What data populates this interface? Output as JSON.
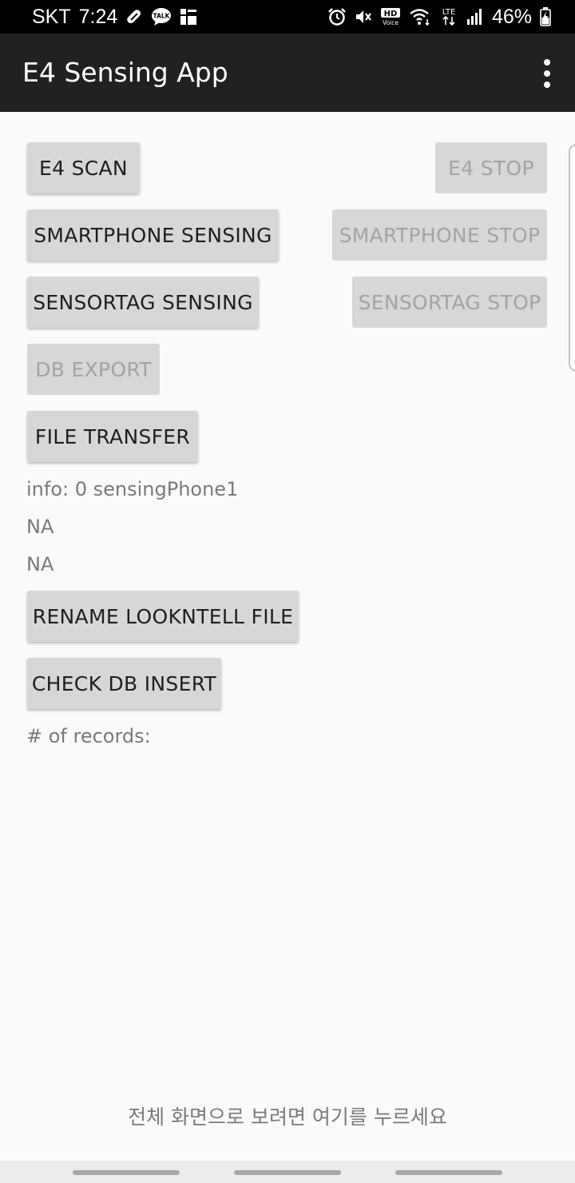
{
  "status_bar": {
    "carrier": "SKT",
    "time": "7:24",
    "battery_percent": "46%",
    "left_icons": [
      "pill-icon",
      "talk-icon",
      "news-icon"
    ],
    "right_icons": [
      "alarm-icon",
      "mute-icon",
      "hd-voice-icon",
      "wifi-icon",
      "lte-icon",
      "signal-icon",
      "battery-charging-icon"
    ],
    "hd_label": "HD",
    "voice_label": "Voice",
    "lte_label": "LTE",
    "talk_label": "TALK"
  },
  "app_bar": {
    "title": "E4 Sensing App",
    "menu_icon": "more-vert-icon"
  },
  "buttons": {
    "e4_scan": "E4 SCAN",
    "e4_stop": "E4 STOP",
    "smartphone_sensing": "SMARTPHONE SENSING",
    "smartphone_stop": "SMARTPHONE STOP",
    "sensortag_sensing": "SENSORTAG SENSING",
    "sensortag_stop": "SENSORTAG STOP",
    "db_export": "DB EXPORT",
    "file_transfer": "FILE TRANSFER",
    "rename_lookntell": "RENAME LOOKNTELL FILE",
    "check_db_insert": "CHECK DB INSERT"
  },
  "info": {
    "info_line": "info: 0 sensingPhone1",
    "value1": "NA",
    "value2": "NA",
    "records_label": "# of records:"
  },
  "fullscreen_hint": "전체 화면으로 보려면 여기를 누르세요",
  "colors": {
    "app_bar": "#212121",
    "button_bg": "#d6d7d7",
    "button_disabled_text": "#a3a4a4",
    "secondary_text": "#7a7a7a"
  }
}
